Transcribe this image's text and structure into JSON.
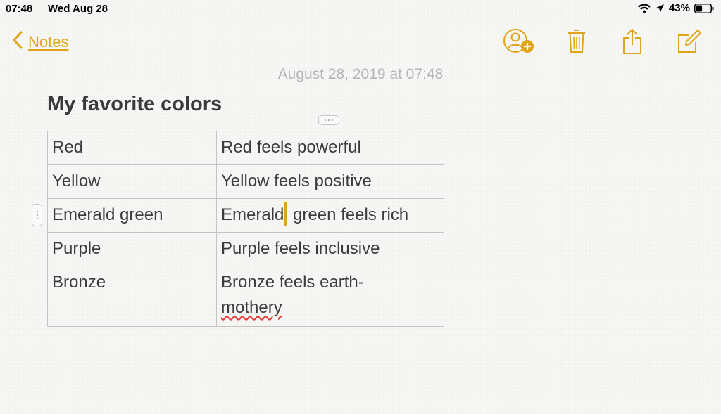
{
  "status_bar": {
    "time": "07:48",
    "date": "Wed Aug 28",
    "battery_percent": "43%",
    "battery_level": 0.43,
    "icons": [
      "wifi-icon",
      "location-icon",
      "battery-icon"
    ]
  },
  "toolbar": {
    "back_label": "Notes",
    "icons": [
      "add-person-icon",
      "trash-icon",
      "share-icon",
      "compose-icon"
    ]
  },
  "note": {
    "date": "August 28, 2019 at 07:48",
    "title": "My favorite colors",
    "table": {
      "rows": [
        {
          "color": "Red",
          "feeling": "Red feels powerful"
        },
        {
          "color": "Yellow",
          "feeling": "Yellow feels positive"
        },
        {
          "color": "Emerald green",
          "feeling_before_caret": "Emerald",
          "feeling_after_caret": " green feels rich"
        },
        {
          "color": "Purple",
          "feeling": "Purple feels inclusive"
        },
        {
          "color": "Bronze",
          "feeling_line1": "Bronze feels earth-",
          "feeling_line2": "mothery"
        }
      ]
    }
  },
  "colors": {
    "accent": "#e0a41a",
    "text": "#3c3c3c",
    "date_text": "#b5b5b5",
    "grid": "#c4c4c4",
    "spell_error": "#e53935"
  }
}
